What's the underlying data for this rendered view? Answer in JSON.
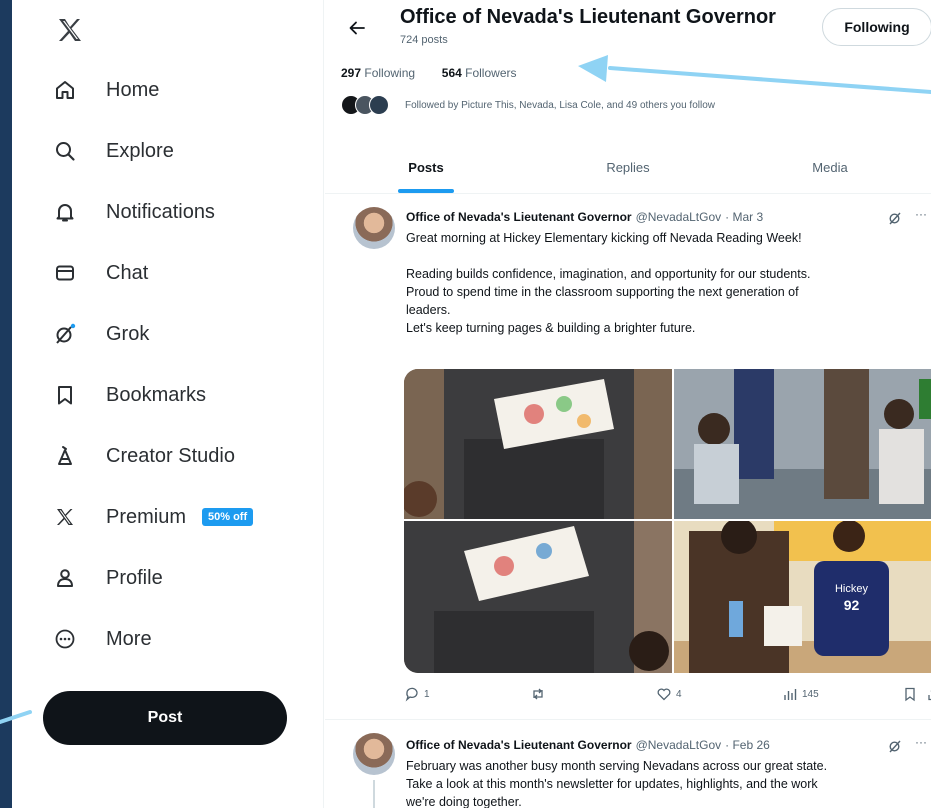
{
  "sidebar": {
    "logo": "x-logo-icon",
    "items": [
      {
        "label": "Home",
        "icon": "home-icon"
      },
      {
        "label": "Explore",
        "icon": "search-icon"
      },
      {
        "label": "Notifications",
        "icon": "bell-icon"
      },
      {
        "label": "Chat",
        "icon": "mail-icon"
      },
      {
        "label": "Grok",
        "icon": "grok-icon"
      },
      {
        "label": "Bookmarks",
        "icon": "bookmark-icon"
      },
      {
        "label": "Creator Studio",
        "icon": "creator-studio-icon"
      },
      {
        "label": "Premium",
        "icon": "x-premium-icon",
        "badge": "50% off"
      },
      {
        "label": "Profile",
        "icon": "person-icon"
      },
      {
        "label": "More",
        "icon": "more-circle-icon"
      }
    ],
    "post_label": "Post"
  },
  "profile": {
    "name": "Office of Nevada's Lieutenant Governor",
    "post_count": "724 posts",
    "follow_button": "Following",
    "following_count": "297",
    "following_label": "Following",
    "followers_count": "564",
    "followers_label": "Followers",
    "followed_by": "Followed by Picture This, Nevada, Lisa Cole, and 49 others you follow"
  },
  "tabs": [
    "Posts",
    "Replies",
    "Media"
  ],
  "tweets": [
    {
      "name": "Office of Nevada's Lieutenant Governor",
      "handle": "@NevadaLtGov",
      "date": "· Mar 3",
      "lines": [
        "Great morning at Hickey Elementary kicking off Nevada Reading Week!",
        "",
        "Reading builds confidence, imagination, and opportunity for our students.",
        "Proud to spend time in the classroom supporting the next generation of",
        "leaders.",
        "Let's keep turning pages & building a brighter future."
      ],
      "jersey_text": "Hickey",
      "jersey_number": "92",
      "replies": "1",
      "reposts": "",
      "likes": "4",
      "views": "145"
    },
    {
      "name": "Office of Nevada's Lieutenant Governor",
      "handle": "@NevadaLtGov",
      "date": "· Feb 26",
      "lines": [
        "February was another busy month serving Nevadans across our great state.",
        "Take a look at this month's newsletter for updates, highlights, and the work",
        "we're doing together."
      ]
    }
  ],
  "colors": {
    "accent": "#1d9bf0",
    "background": "#1c3a5e",
    "annotation_arrow": "#8fd3f4"
  }
}
